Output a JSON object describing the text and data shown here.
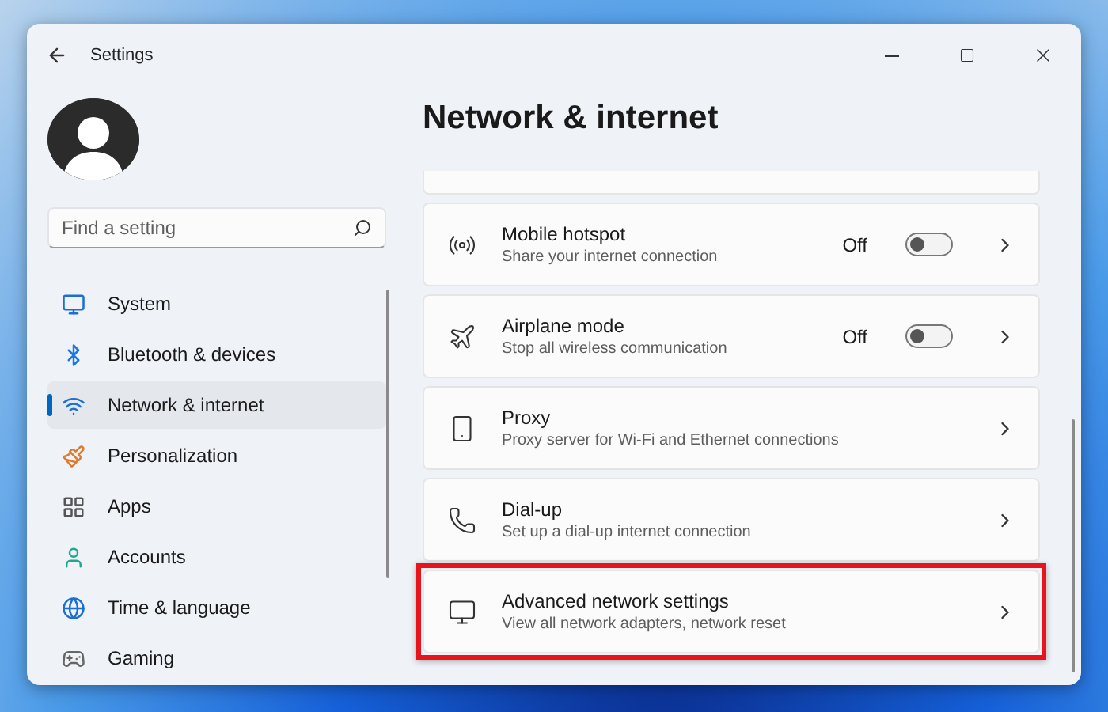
{
  "window": {
    "title": "Settings"
  },
  "search": {
    "placeholder": "Find a setting"
  },
  "sidebar": {
    "items": [
      {
        "label": "System",
        "kind": "system",
        "selected": false
      },
      {
        "label": "Bluetooth & devices",
        "kind": "bluetooth",
        "selected": false
      },
      {
        "label": "Network & internet",
        "kind": "network",
        "selected": true
      },
      {
        "label": "Personalization",
        "kind": "brush",
        "selected": false
      },
      {
        "label": "Apps",
        "kind": "apps",
        "selected": false
      },
      {
        "label": "Accounts",
        "kind": "accounts",
        "selected": false
      },
      {
        "label": "Time & language",
        "kind": "time",
        "selected": false
      },
      {
        "label": "Gaming",
        "kind": "gaming",
        "selected": false
      }
    ]
  },
  "page": {
    "title": "Network & internet"
  },
  "settings": [
    {
      "kind": "hotspot",
      "title": "Mobile hotspot",
      "subtitle": "Share your internet connection",
      "toggle": {
        "label": "Off",
        "on": false
      },
      "highlighted": false
    },
    {
      "kind": "airplane",
      "title": "Airplane mode",
      "subtitle": "Stop all wireless communication",
      "toggle": {
        "label": "Off",
        "on": false
      },
      "highlighted": false
    },
    {
      "kind": "proxy",
      "title": "Proxy",
      "subtitle": "Proxy server for Wi-Fi and Ethernet connections",
      "highlighted": false
    },
    {
      "kind": "dialup",
      "title": "Dial-up",
      "subtitle": "Set up a dial-up internet connection",
      "highlighted": false
    },
    {
      "kind": "advanced",
      "title": "Advanced network settings",
      "subtitle": "View all network adapters, network reset",
      "highlighted": true
    }
  ]
}
